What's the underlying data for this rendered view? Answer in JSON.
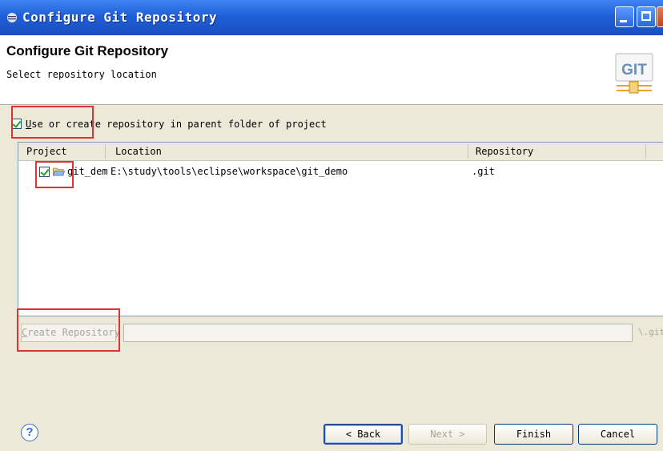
{
  "window": {
    "title": "Configure Git Repository"
  },
  "header": {
    "title": "Configure Git Repository",
    "subtitle": "Select repository location",
    "logo_text": "GIT"
  },
  "checkbox": {
    "label_prefix": "U",
    "label_rest": "se or create repository in parent folder of project",
    "checked": true
  },
  "table": {
    "headers": {
      "project": "Project",
      "location": "Location",
      "repository": "Repository"
    },
    "rows": [
      {
        "project": "git_dem",
        "location": "E:\\study\\tools\\eclipse\\workspace\\git_demo",
        "repository": ".git",
        "checked": true
      }
    ]
  },
  "create": {
    "button_prefix": "C",
    "button_rest": "reate Repository",
    "field_value": "",
    "suffix": "\\.git"
  },
  "buttons": {
    "back": "< Back",
    "next": "Next >",
    "finish": "Finish",
    "cancel": "Cancel",
    "help": "?"
  },
  "colors": {
    "titlebar": "#1f5fd8",
    "highlight": "#e03232",
    "check": "#21a121"
  }
}
